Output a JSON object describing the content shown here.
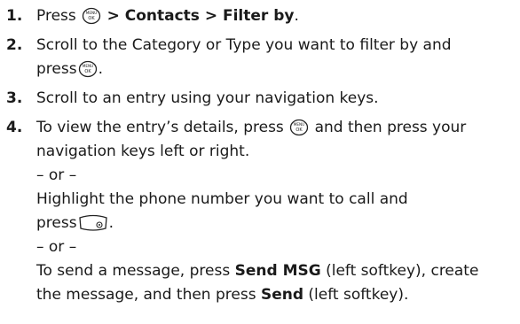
{
  "steps": [
    {
      "number": "1.",
      "press": "Press",
      "menu_path": "> Contacts > Filter by",
      "end": ".",
      "key_icon": "menu-ok-key-icon"
    },
    {
      "number": "2.",
      "line1": "Scroll to the Category or Type you want to filter by and",
      "line2_pre": "press",
      "line2_post": ".",
      "key_icon": "menu-ok-key-icon"
    },
    {
      "number": "3.",
      "text": "Scroll to an entry using your navigation keys."
    },
    {
      "number": "4.",
      "line1_pre": "To view the entry’s details, press",
      "line1_post": "and then press your",
      "line2": "navigation keys left or right.",
      "or_1": "– or –",
      "line4": "Highlight the phone number you want to call and",
      "line5_pre": "press",
      "line5_post": ".",
      "or_2": "– or –",
      "line7_pre": "To send a message, press",
      "send_msg": "Send MSG",
      "line7_post": "(left softkey), create",
      "line8_pre": "the message, and then press",
      "send": "Send",
      "line8_post": "(left softkey).",
      "key_icon": "menu-ok-key-icon",
      "talk_icon": "talk-key-icon"
    }
  ]
}
